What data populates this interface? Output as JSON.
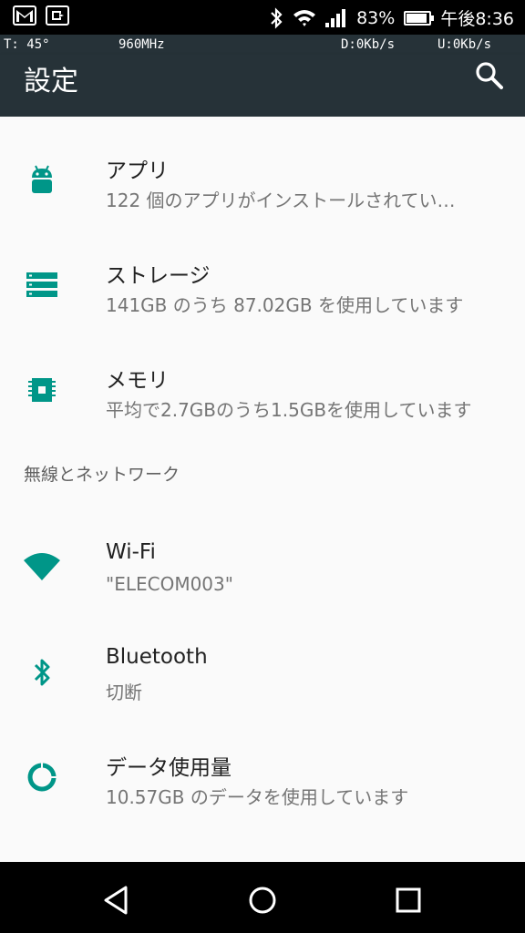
{
  "statusbar": {
    "battery": "83%",
    "time": "午後8:36",
    "icons": [
      "gmail-icon",
      "sync-icon",
      "bluetooth-icon",
      "wifi-icon",
      "signal-icon",
      "battery-icon"
    ]
  },
  "perf": {
    "temp": "T: 45°",
    "freq": "960MHz",
    "down": "D:0Kb/s",
    "up": "U:0Kb/s"
  },
  "appbar": {
    "title": "設定"
  },
  "items": [
    {
      "title": "アプリ",
      "summary": "122 個のアプリがインストールされてい…",
      "icon": "android-icon"
    },
    {
      "title": "ストレージ",
      "summary": "141GB のうち 87.02GB を使用しています",
      "icon": "storage-icon"
    },
    {
      "title": "メモリ",
      "summary": "平均で2.7GBのうち1.5GBを使用しています",
      "icon": "memory-icon"
    }
  ],
  "category": "無線とネットワーク",
  "network_items": [
    {
      "title": "Wi-Fi",
      "summary": "\"ELECOM003\"",
      "icon": "wifi-icon"
    },
    {
      "title": "Bluetooth",
      "summary": "切断",
      "icon": "bluetooth-icon"
    },
    {
      "title": "データ使用量",
      "summary": "10.57GB のデータを使用しています",
      "icon": "data-usage-icon"
    }
  ],
  "colors": {
    "accent": "#009688",
    "toolbar": "#263238"
  }
}
